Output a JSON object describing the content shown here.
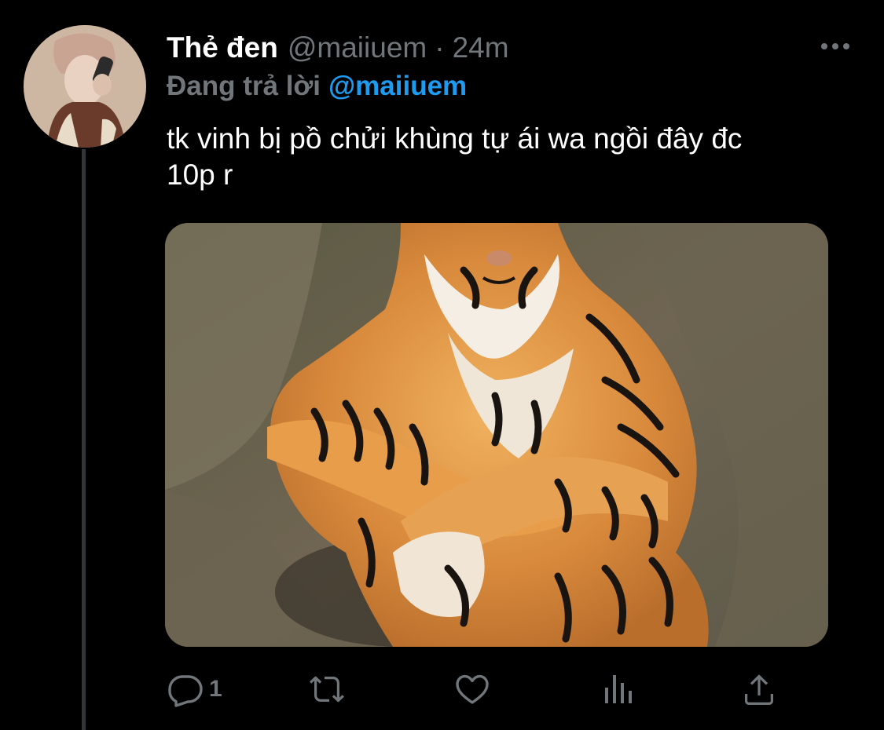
{
  "tweet": {
    "display_name": "Thẻ đen",
    "handle": "@maiiuem",
    "separator": "·",
    "time": "24m",
    "replying_prefix": "Đang trả lời",
    "replying_to": "@maiiuem",
    "text": "tk vinh bị pồ chửi khùng tự ái wa ngồi đây đc\n10p r"
  },
  "media": {
    "kind": "photo",
    "subject": "tiger-sitting"
  },
  "actions": {
    "reply_count": "1",
    "retweet_count": "",
    "like_count": "",
    "icons": [
      "reply-icon",
      "retweet-icon",
      "like-icon",
      "analytics-icon",
      "share-icon"
    ]
  },
  "colors": {
    "background": "#000000",
    "name": "#ffffff",
    "muted": "#71767b",
    "mention": "#1d9bf0",
    "thread_line": "#333639"
  }
}
